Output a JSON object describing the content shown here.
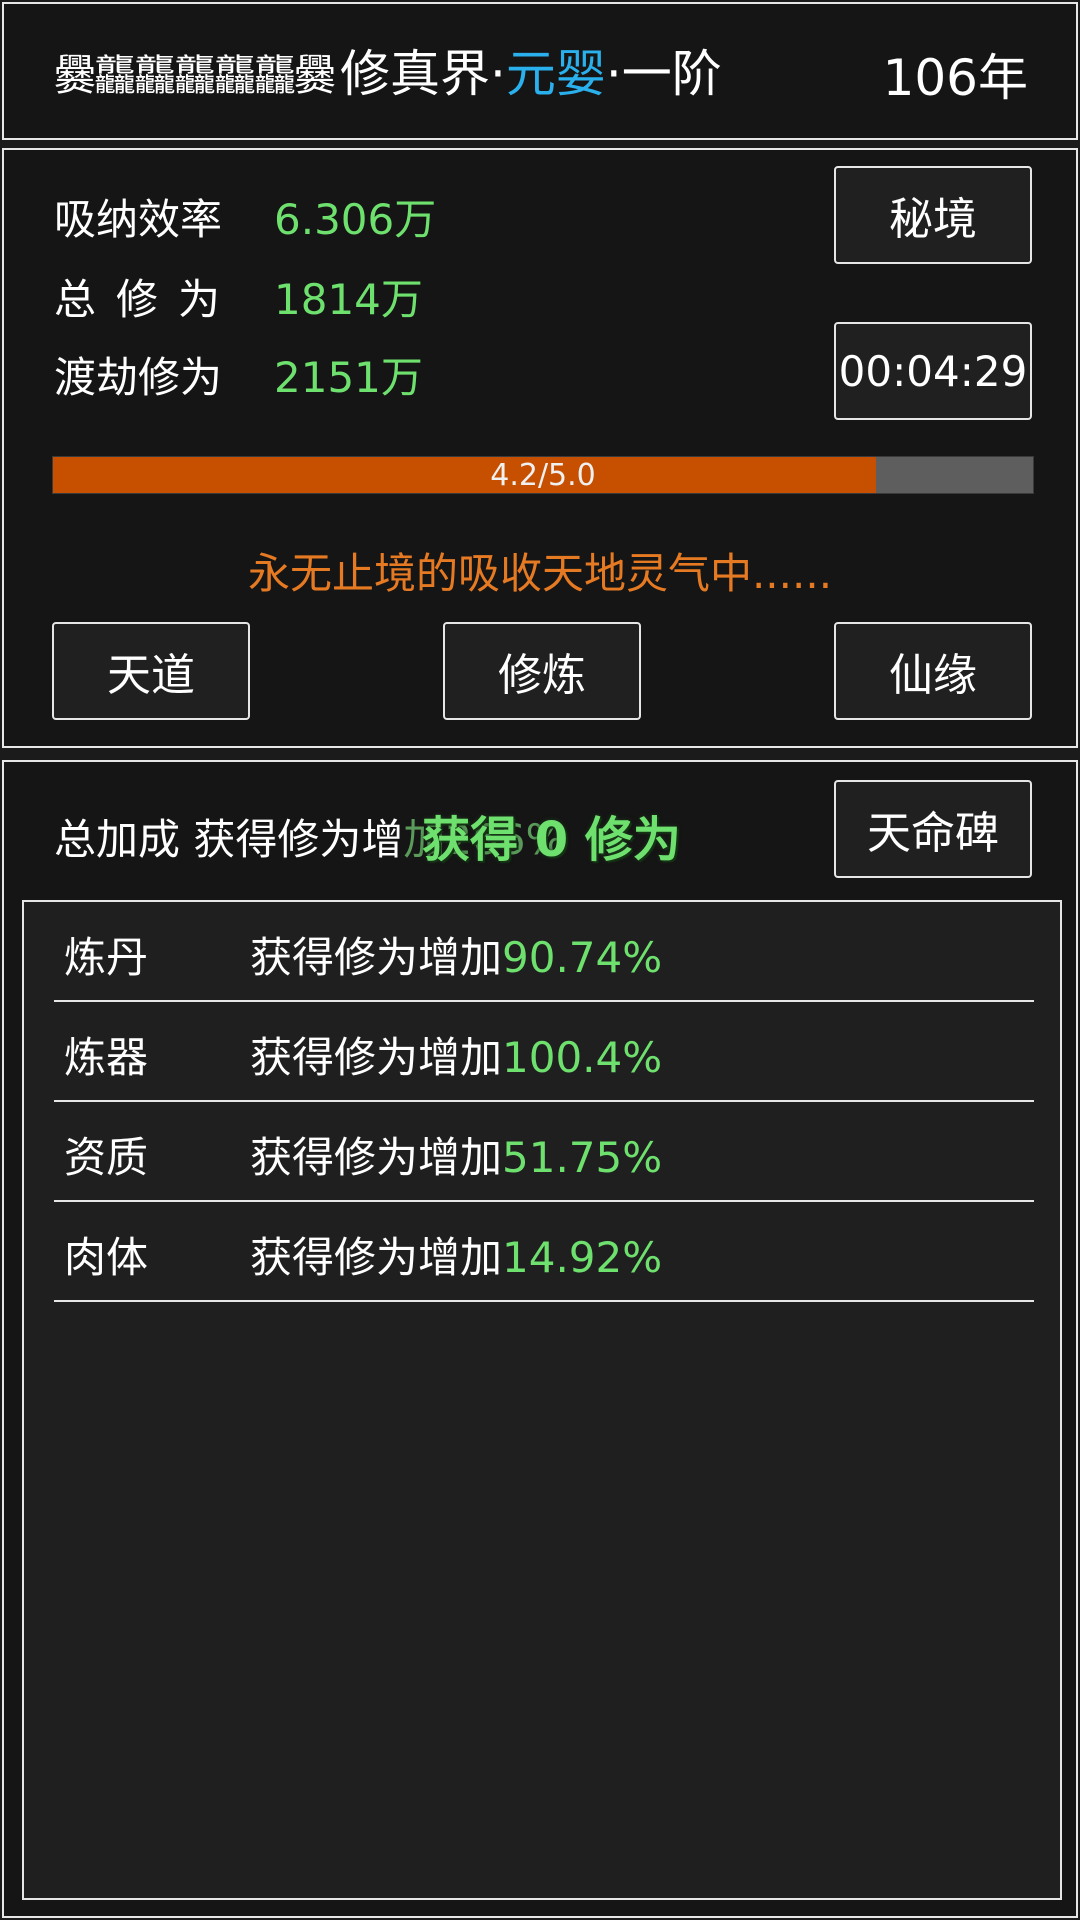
{
  "header": {
    "player_name": "爨龘龘龘龘龘爨",
    "realm_prefix": "修真界·",
    "realm_highlight": "元婴",
    "realm_suffix": "·一阶",
    "year": "106年"
  },
  "stats": {
    "absorb_label": "吸纳效率",
    "absorb_value": "6.306万",
    "total_label": "总修为",
    "total_value": "1814万",
    "tribulation_label": "渡劫修为",
    "tribulation_value": "2151万"
  },
  "buttons": {
    "secret_realm": "秘境",
    "timer": "00:04:29",
    "heaven_dao": "天道",
    "cultivate": "修炼",
    "immortal_fate": "仙缘",
    "destiny_stele": "天命碑"
  },
  "progress": {
    "label": "4.2/5.0",
    "value": 4.2,
    "max": 5.0
  },
  "status_text": "永无止境的吸收天地灵气中......",
  "bonus": {
    "summary_label": "总加成 获得修为增",
    "summary_faded": "加266%",
    "float_text": "获得 0 修为",
    "rows": [
      {
        "category": "炼丹",
        "desc": "获得修为增加",
        "percent": "90.74%"
      },
      {
        "category": "炼器",
        "desc": "获得修为增加",
        "percent": "100.4%"
      },
      {
        "category": "资质",
        "desc": "获得修为增加",
        "percent": "51.75%"
      },
      {
        "category": "肉体",
        "desc": "获得修为增加",
        "percent": "14.92%"
      }
    ]
  },
  "colors": {
    "accent_green": "#6ee06e",
    "realm_blue": "#2ab0ec",
    "progress_orange": "#c65000",
    "status_orange": "#e67a22"
  }
}
